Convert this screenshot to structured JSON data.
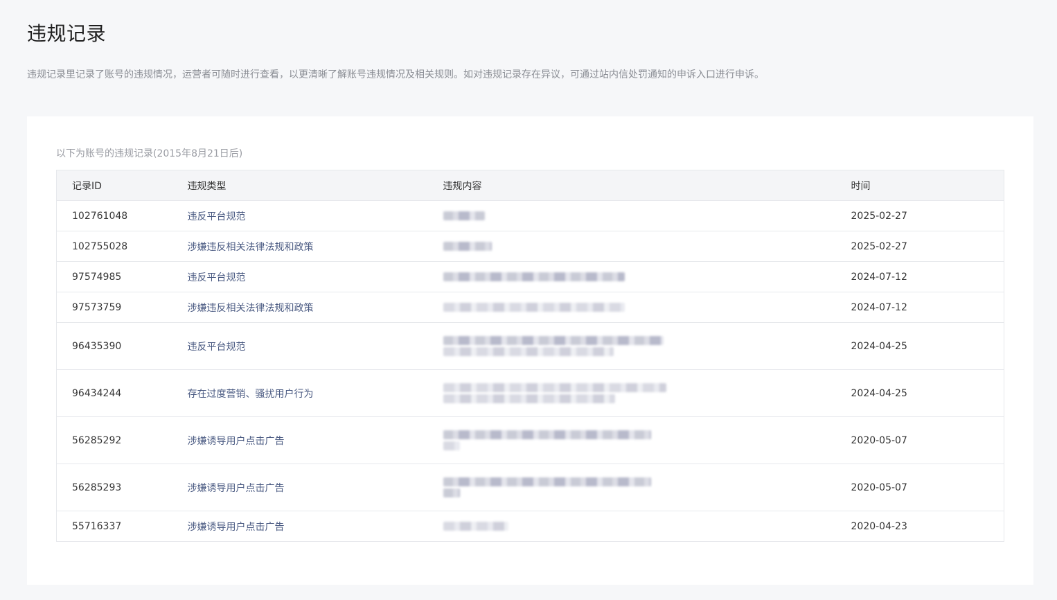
{
  "page": {
    "title": "违规记录",
    "description": "违规记录里记录了账号的违规情况，运营者可随时进行查看，以更清晰了解账号违规情况及相关规则。如对违规记录存在异议，可通过站内信处罚通知的申诉入口进行申诉。"
  },
  "records": {
    "caption": "以下为账号的违规记录(2015年8月21日后)",
    "columns": {
      "id": "记录ID",
      "type": "违规类型",
      "content": "违规内容",
      "time": "时间"
    },
    "rows": [
      {
        "id": "102761048",
        "type": "违反平台规范",
        "time": "2025-02-27"
      },
      {
        "id": "102755028",
        "type": "涉嫌违反相关法律法规和政策",
        "time": "2025-02-27"
      },
      {
        "id": "97574985",
        "type": "违反平台规范",
        "time": "2024-07-12"
      },
      {
        "id": "97573759",
        "type": "涉嫌违反相关法律法规和政策",
        "time": "2024-07-12"
      },
      {
        "id": "96435390",
        "type": "违反平台规范",
        "time": "2024-04-25"
      },
      {
        "id": "96434244",
        "type": "存在过度营销、骚扰用户行为",
        "time": "2024-04-25"
      },
      {
        "id": "56285292",
        "type": "涉嫌诱导用户点击广告",
        "time": "2020-05-07"
      },
      {
        "id": "56285293",
        "type": "涉嫌诱导用户点击广告",
        "time": "2020-05-07"
      },
      {
        "id": "55716337",
        "type": "涉嫌诱导用户点击广告",
        "time": "2020-04-23"
      }
    ]
  },
  "colors": {
    "background": "#f6f7f9",
    "card": "#ffffff",
    "type_link": "#4a5a82",
    "muted_text": "#8a8d94"
  }
}
